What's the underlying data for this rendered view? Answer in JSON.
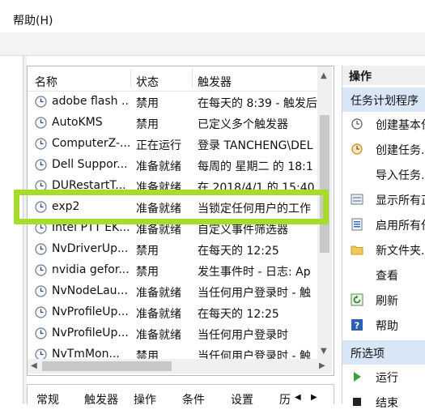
{
  "menu": {
    "help_label": "帮助(H)"
  },
  "columns": {
    "name": "名称",
    "status": "状态",
    "trigger": "触发器"
  },
  "tasks": [
    {
      "name": "adobe flash ...",
      "status": "禁用",
      "trigger": "在每天的 8:39 - 触发后"
    },
    {
      "name": "AutoKMS",
      "status": "禁用",
      "trigger": "已定义多个触发器"
    },
    {
      "name": "ComputerZ-...",
      "status": "正在运行",
      "trigger": "登录 TANCHENG\\DEL"
    },
    {
      "name": "Dell Suppor...",
      "status": "准备就绪",
      "trigger": "每周的 星期二 的 18:1"
    },
    {
      "name": "DURestartT...",
      "status": "准备就绪",
      "trigger": "在 2018/4/1 的 15:40"
    },
    {
      "name": "exp2",
      "status": "准备就绪",
      "trigger": "当锁定任何用户的工作"
    },
    {
      "name": "Intel PTT EK...",
      "status": "准备就绪",
      "trigger": "自定义事件筛选器"
    },
    {
      "name": "NvDriverUp...",
      "status": "禁用",
      "trigger": "在每天的 12:25"
    },
    {
      "name": "nvidia gefor...",
      "status": "禁用",
      "trigger": "发生事件时 - 日志: Ap"
    },
    {
      "name": "NvNodeLau...",
      "status": "准备就绪",
      "trigger": "当任何用户登录时 - 触"
    },
    {
      "name": "NvProfileUp...",
      "status": "准备就绪",
      "trigger": "在每天的 12:25"
    },
    {
      "name": "NvProfileUp...",
      "status": "准备就绪",
      "trigger": "当任何用户登录时"
    },
    {
      "name": "NvTmMon...",
      "status": "禁用",
      "trigger": "当任何用户登录时 - 触"
    }
  ],
  "tabs": [
    "常规",
    "触发器",
    "操作",
    "条件",
    "设置",
    "历"
  ],
  "actions_panel": {
    "header": "操作",
    "section1": "任务计划程序",
    "items": [
      {
        "label": "创建基本任务",
        "icon": "create-basic-task-icon"
      },
      {
        "label": "创建任务...",
        "icon": "create-task-icon"
      },
      {
        "label": "导入任务...",
        "icon": "none"
      },
      {
        "label": "显示所有正",
        "icon": "display-running-icon"
      },
      {
        "label": "启用所有任",
        "icon": "enable-history-icon"
      },
      {
        "label": "新文件夹...",
        "icon": "folder-icon"
      },
      {
        "label": "查看",
        "icon": "none"
      },
      {
        "label": "刷新",
        "icon": "refresh-icon"
      },
      {
        "label": "帮助",
        "icon": "help-icon"
      }
    ],
    "section2": "所选项",
    "items2": [
      {
        "label": "运行",
        "icon": "run-icon"
      },
      {
        "label": "结束",
        "icon": "end-icon"
      }
    ]
  },
  "colors": {
    "highlight": "#a6dc2a",
    "section_bg": "#d9e6f5"
  }
}
